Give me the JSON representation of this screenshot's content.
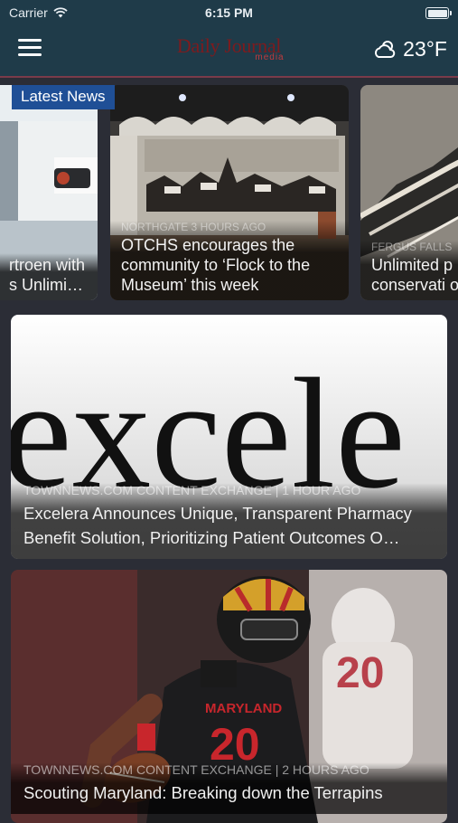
{
  "status_bar": {
    "carrier": "Carrier",
    "time": "6:15 PM"
  },
  "navbar": {
    "logo_main": "Daily Journal",
    "logo_sub": "media",
    "temperature": "23°F",
    "weather_icon": "partly-cloudy-icon"
  },
  "carousel": {
    "badge": "Latest News",
    "cards": [
      {
        "meta": "",
        "title": "rtroen with s Unlimi…"
      },
      {
        "meta": "NORTHGATE 3 HOURS AGO",
        "title": "OTCHS encourages the community to ‘Flock to the Museum’ this week"
      },
      {
        "meta": "FERGUS FALLS",
        "title": "Unlimited p conservati of Maidens"
      }
    ]
  },
  "stories": [
    {
      "meta": "TOWNNEWS.COM CONTENT EXCHANGE | 1 HOUR AGO",
      "title": "Excelera Announces Unique, Transparent Pharmacy Benefit Solution, Prioritizing Patient Outcomes O…",
      "image_text": "excele"
    },
    {
      "meta": "TOWNNEWS.COM CONTENT EXCHANGE | 2 HOURS AGO",
      "title": "Scouting Maryland: Breaking down the Terrapins",
      "image_text_jersey": "MARYLAND",
      "image_text_number": "20"
    }
  ],
  "colors": {
    "nav_bg": "#1f3b49",
    "badge_bg": "#1f4f96",
    "page_bg": "#2b2d36"
  }
}
